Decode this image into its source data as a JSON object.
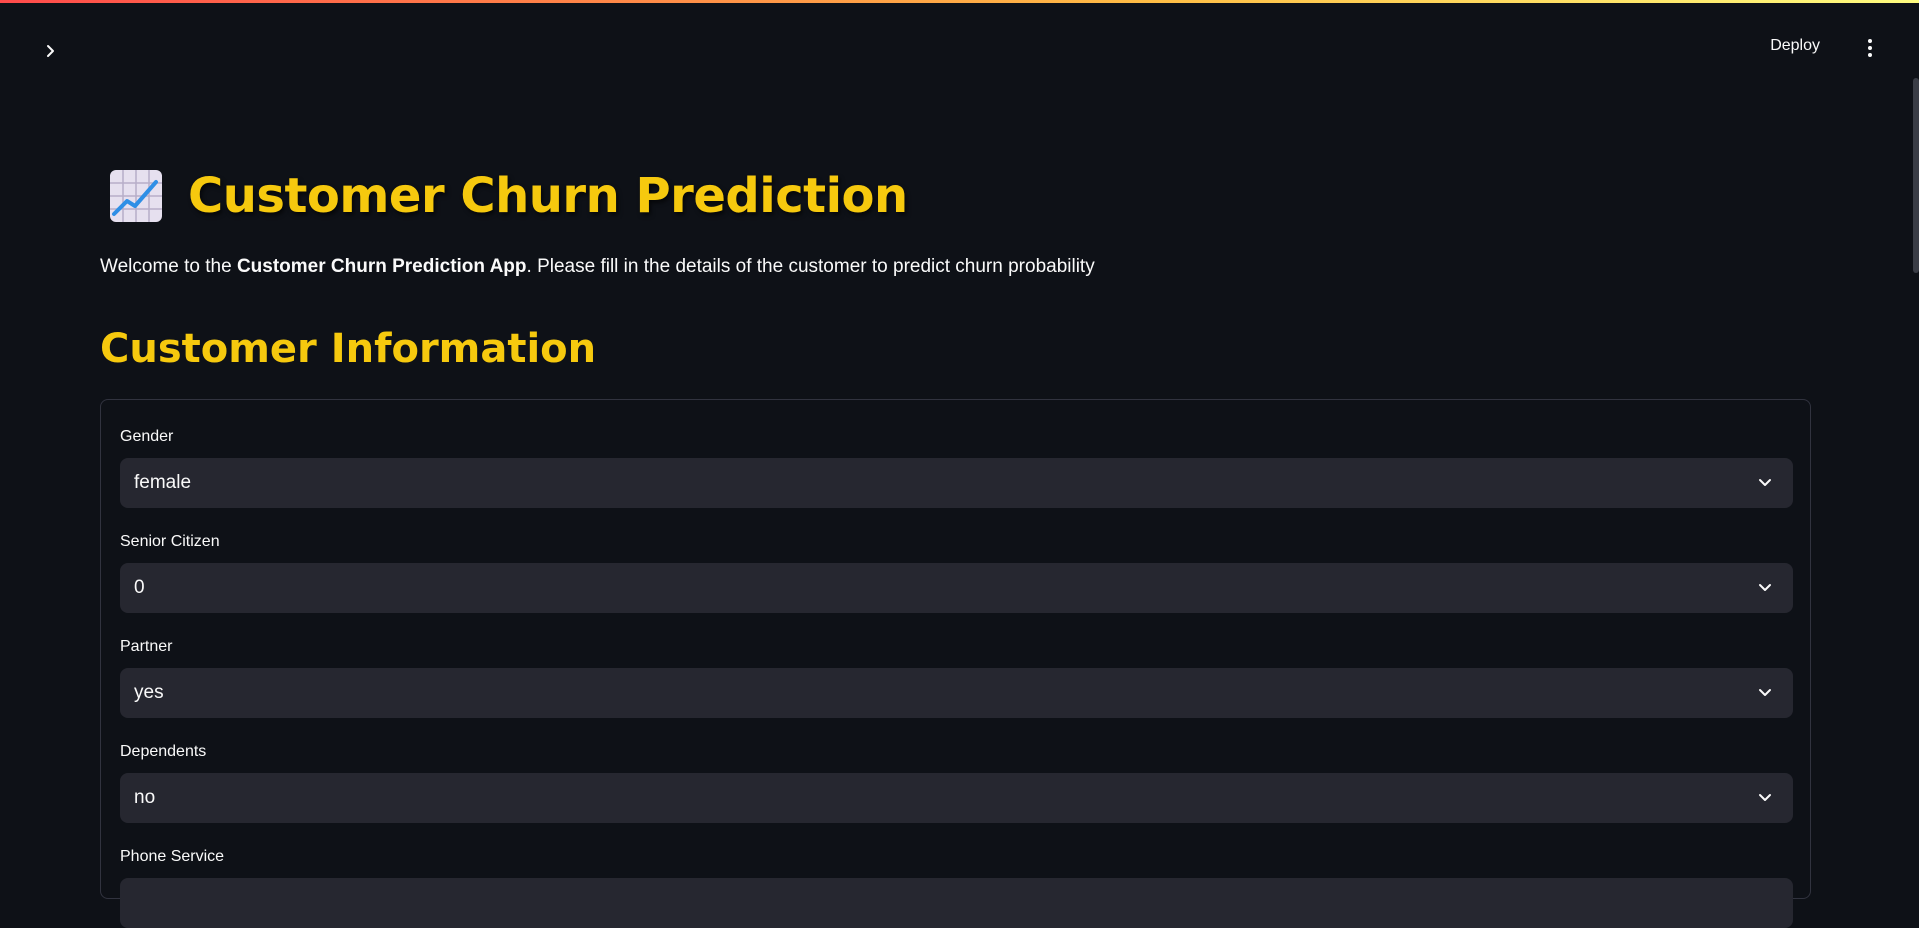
{
  "header": {
    "deploy_label": "Deploy"
  },
  "page": {
    "title": "Customer Churn Prediction",
    "title_icon": "chart-increasing-emoji",
    "intro_prefix": "Welcome to the ",
    "intro_bold": "Customer Churn Prediction App",
    "intro_suffix": ". Please fill in the details of the customer to predict churn probability",
    "section_title": "Customer Information"
  },
  "form": {
    "fields": [
      {
        "label": "Gender",
        "value": "female"
      },
      {
        "label": "Senior Citizen",
        "value": "0"
      },
      {
        "label": "Partner",
        "value": "yes"
      },
      {
        "label": "Dependents",
        "value": "no"
      },
      {
        "label": "Phone Service",
        "value": ""
      }
    ]
  },
  "colors": {
    "background": "#0e1117",
    "accent_title": "#f6c90e",
    "select_bg": "#262730",
    "border": "#31333f"
  }
}
